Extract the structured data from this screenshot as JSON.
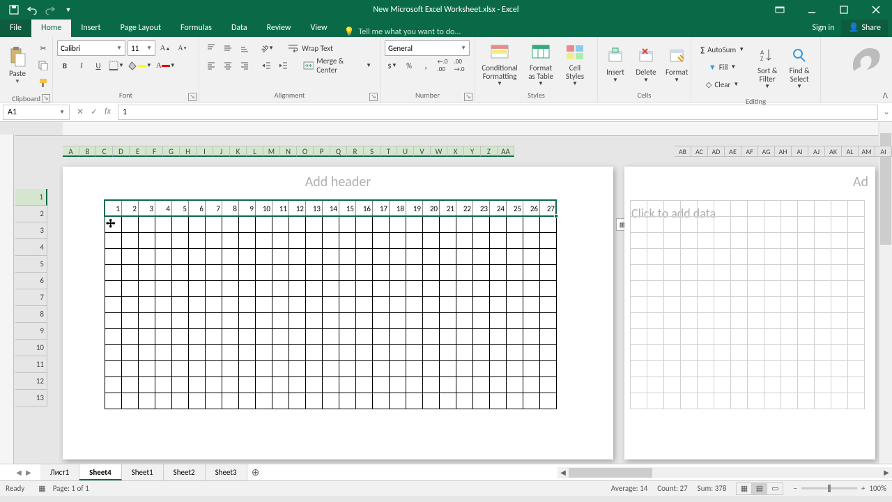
{
  "titlebar": {
    "title": "New Microsoft Excel Worksheet.xlsx - Excel"
  },
  "tabs": {
    "file": "File",
    "home": "Home",
    "insert": "Insert",
    "pagelayout": "Page Layout",
    "formulas": "Formulas",
    "data": "Data",
    "review": "Review",
    "view": "View",
    "tellme": "Tell me what you want to do...",
    "signin": "Sign in",
    "share": "Share"
  },
  "ribbon": {
    "clipboard": {
      "paste": "Paste",
      "label": "Clipboard"
    },
    "font": {
      "name": "Calibri",
      "size": "11",
      "bold": "B",
      "italic": "I",
      "underline": "U",
      "label": "Font"
    },
    "alignment": {
      "wrap": "Wrap Text",
      "merge": "Merge & Center",
      "label": "Alignment"
    },
    "number": {
      "format": "General",
      "label": "Number"
    },
    "styles": {
      "cond": "Conditional Formatting",
      "table": "Format as Table",
      "cell": "Cell Styles",
      "label": "Styles"
    },
    "cells": {
      "insert": "Insert",
      "delete": "Delete",
      "format": "Format",
      "label": "Cells"
    },
    "editing": {
      "autosum": "AutoSum",
      "fill": "Fill",
      "clear": "Clear",
      "sort": "Sort & Filter",
      "find": "Find & Select",
      "label": "Editing"
    }
  },
  "formulabar": {
    "name": "A1",
    "value": "1"
  },
  "workspace": {
    "addheader": "Add header",
    "addheader2": "Ad",
    "clickadd": "Click to add data",
    "columns": [
      "A",
      "B",
      "C",
      "D",
      "E",
      "F",
      "G",
      "H",
      "I",
      "J",
      "K",
      "L",
      "M",
      "N",
      "O",
      "P",
      "Q",
      "R",
      "S",
      "T",
      "U",
      "V",
      "W",
      "X",
      "Y",
      "Z",
      "AA"
    ],
    "columns2": [
      "AB",
      "AC",
      "AD",
      "AE",
      "AF",
      "AG",
      "AH",
      "AI",
      "AJ",
      "AK",
      "AL",
      "AM",
      "AI"
    ],
    "rows": [
      "1",
      "2",
      "3",
      "4",
      "5",
      "6",
      "7",
      "8",
      "9",
      "10",
      "11",
      "12",
      "13"
    ],
    "data_row": [
      "1",
      "2",
      "3",
      "4",
      "5",
      "6",
      "7",
      "8",
      "9",
      "10",
      "11",
      "12",
      "13",
      "14",
      "15",
      "16",
      "17",
      "18",
      "19",
      "20",
      "21",
      "22",
      "23",
      "24",
      "25",
      "26",
      "27"
    ]
  },
  "sheets": {
    "nav1": "Лист1",
    "active": "Sheet4",
    "s1": "Sheet1",
    "s2": "Sheet2",
    "s3": "Sheet3"
  },
  "status": {
    "ready": "Ready",
    "page": "Page: 1 of 1",
    "avg": "Average: 14",
    "count": "Count: 27",
    "sum": "Sum: 378",
    "zoom": "100%"
  }
}
